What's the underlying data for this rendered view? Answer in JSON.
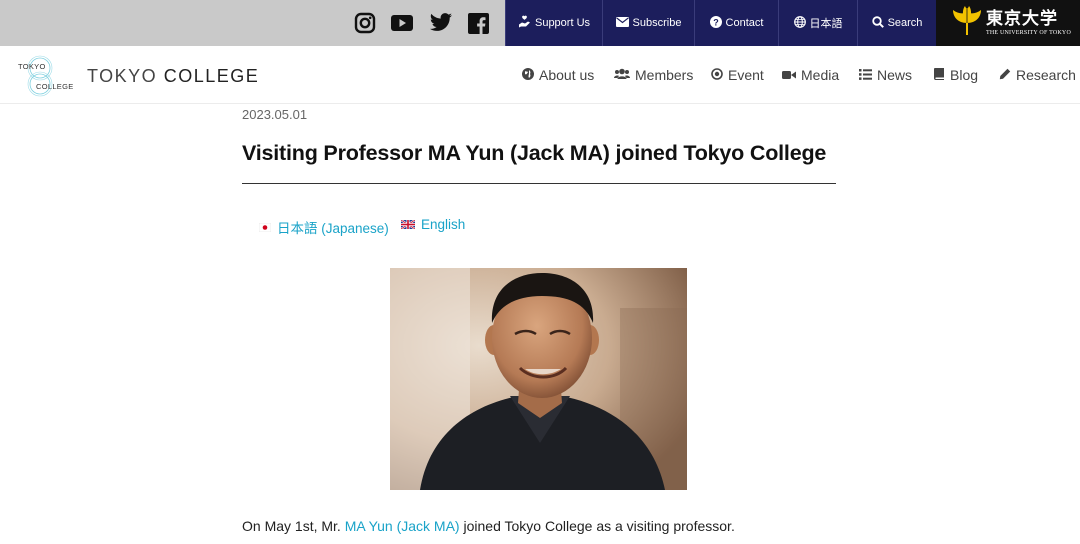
{
  "topbar": {
    "social": [
      "instagram-icon",
      "youtube-icon",
      "twitter-icon",
      "facebook-icon"
    ],
    "links": {
      "support": "Support Us",
      "subscribe": "Subscribe",
      "contact": "Contact",
      "japanese": "日本語",
      "search": "Search"
    },
    "utokyo_kanji": "東京大学",
    "utokyo_english": "THE UNIVERSITY OF TOKYO",
    "bar_color": "#c9c9c9",
    "button_color": "#1c1e5c"
  },
  "header": {
    "logo_mark_top": "TOKYO",
    "logo_mark_bottom": "COLLEGE",
    "logo_text_a": "TOKYO",
    "logo_text_b": "COLLEGE",
    "nav": {
      "about": "About us",
      "members": "Members",
      "event": "Event",
      "media": "Media",
      "news": "News",
      "blog": "Blog",
      "research": "Research"
    }
  },
  "article": {
    "date": "2023.05.01",
    "title": "Visiting Professor MA Yun (Jack MA) joined Tokyo College",
    "languages": {
      "japanese": "日本語 (Japanese)",
      "english": "English"
    },
    "body_prefix": "On May 1st, Mr. ",
    "body_link": "MA Yun (Jack MA)",
    "body_suffix": " joined Tokyo College as a visiting professor.",
    "link_color": "#1aa3c8"
  }
}
